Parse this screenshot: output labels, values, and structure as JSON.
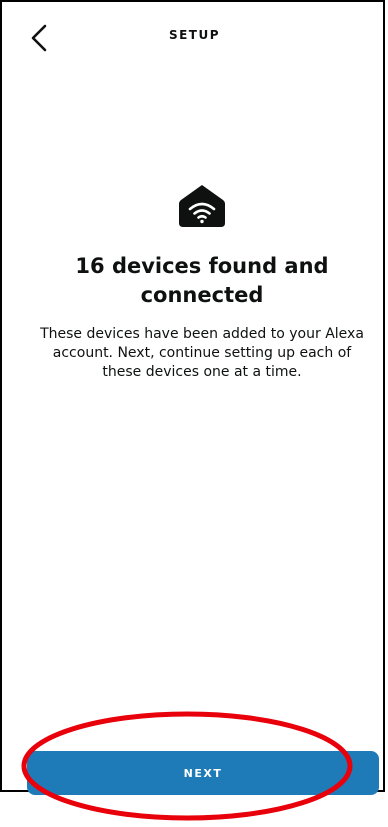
{
  "header": {
    "title": "SETUP",
    "back_icon": "chevron-left-icon"
  },
  "status": {
    "icon": "smart-home-wifi-icon",
    "headline_line1": "16 devices found and",
    "headline_line2": "connected",
    "description_line1": "These devices have been added to your Alexa",
    "description_line2": "account. Next, continue setting up each of",
    "description_line3": "these devices one at a time."
  },
  "footer": {
    "next_label": "NEXT"
  },
  "colors": {
    "accent": "#1f7ab8",
    "annotation": "#e8000a",
    "text": "#0f1111"
  }
}
